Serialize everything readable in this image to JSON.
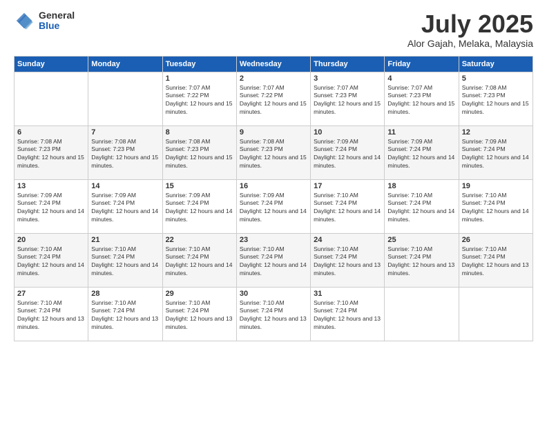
{
  "header": {
    "logo": {
      "general": "General",
      "blue": "Blue"
    },
    "title": "July 2025",
    "location": "Alor Gajah, Melaka, Malaysia"
  },
  "calendar": {
    "days_of_week": [
      "Sunday",
      "Monday",
      "Tuesday",
      "Wednesday",
      "Thursday",
      "Friday",
      "Saturday"
    ],
    "weeks": [
      [
        {
          "day": "",
          "info": ""
        },
        {
          "day": "",
          "info": ""
        },
        {
          "day": "1",
          "info": "Sunrise: 7:07 AM\nSunset: 7:22 PM\nDaylight: 12 hours and 15 minutes."
        },
        {
          "day": "2",
          "info": "Sunrise: 7:07 AM\nSunset: 7:22 PM\nDaylight: 12 hours and 15 minutes."
        },
        {
          "day": "3",
          "info": "Sunrise: 7:07 AM\nSunset: 7:23 PM\nDaylight: 12 hours and 15 minutes."
        },
        {
          "day": "4",
          "info": "Sunrise: 7:07 AM\nSunset: 7:23 PM\nDaylight: 12 hours and 15 minutes."
        },
        {
          "day": "5",
          "info": "Sunrise: 7:08 AM\nSunset: 7:23 PM\nDaylight: 12 hours and 15 minutes."
        }
      ],
      [
        {
          "day": "6",
          "info": "Sunrise: 7:08 AM\nSunset: 7:23 PM\nDaylight: 12 hours and 15 minutes."
        },
        {
          "day": "7",
          "info": "Sunrise: 7:08 AM\nSunset: 7:23 PM\nDaylight: 12 hours and 15 minutes."
        },
        {
          "day": "8",
          "info": "Sunrise: 7:08 AM\nSunset: 7:23 PM\nDaylight: 12 hours and 15 minutes."
        },
        {
          "day": "9",
          "info": "Sunrise: 7:08 AM\nSunset: 7:23 PM\nDaylight: 12 hours and 15 minutes."
        },
        {
          "day": "10",
          "info": "Sunrise: 7:09 AM\nSunset: 7:24 PM\nDaylight: 12 hours and 14 minutes."
        },
        {
          "day": "11",
          "info": "Sunrise: 7:09 AM\nSunset: 7:24 PM\nDaylight: 12 hours and 14 minutes."
        },
        {
          "day": "12",
          "info": "Sunrise: 7:09 AM\nSunset: 7:24 PM\nDaylight: 12 hours and 14 minutes."
        }
      ],
      [
        {
          "day": "13",
          "info": "Sunrise: 7:09 AM\nSunset: 7:24 PM\nDaylight: 12 hours and 14 minutes."
        },
        {
          "day": "14",
          "info": "Sunrise: 7:09 AM\nSunset: 7:24 PM\nDaylight: 12 hours and 14 minutes."
        },
        {
          "day": "15",
          "info": "Sunrise: 7:09 AM\nSunset: 7:24 PM\nDaylight: 12 hours and 14 minutes."
        },
        {
          "day": "16",
          "info": "Sunrise: 7:09 AM\nSunset: 7:24 PM\nDaylight: 12 hours and 14 minutes."
        },
        {
          "day": "17",
          "info": "Sunrise: 7:10 AM\nSunset: 7:24 PM\nDaylight: 12 hours and 14 minutes."
        },
        {
          "day": "18",
          "info": "Sunrise: 7:10 AM\nSunset: 7:24 PM\nDaylight: 12 hours and 14 minutes."
        },
        {
          "day": "19",
          "info": "Sunrise: 7:10 AM\nSunset: 7:24 PM\nDaylight: 12 hours and 14 minutes."
        }
      ],
      [
        {
          "day": "20",
          "info": "Sunrise: 7:10 AM\nSunset: 7:24 PM\nDaylight: 12 hours and 14 minutes."
        },
        {
          "day": "21",
          "info": "Sunrise: 7:10 AM\nSunset: 7:24 PM\nDaylight: 12 hours and 14 minutes."
        },
        {
          "day": "22",
          "info": "Sunrise: 7:10 AM\nSunset: 7:24 PM\nDaylight: 12 hours and 14 minutes."
        },
        {
          "day": "23",
          "info": "Sunrise: 7:10 AM\nSunset: 7:24 PM\nDaylight: 12 hours and 14 minutes."
        },
        {
          "day": "24",
          "info": "Sunrise: 7:10 AM\nSunset: 7:24 PM\nDaylight: 12 hours and 13 minutes."
        },
        {
          "day": "25",
          "info": "Sunrise: 7:10 AM\nSunset: 7:24 PM\nDaylight: 12 hours and 13 minutes."
        },
        {
          "day": "26",
          "info": "Sunrise: 7:10 AM\nSunset: 7:24 PM\nDaylight: 12 hours and 13 minutes."
        }
      ],
      [
        {
          "day": "27",
          "info": "Sunrise: 7:10 AM\nSunset: 7:24 PM\nDaylight: 12 hours and 13 minutes."
        },
        {
          "day": "28",
          "info": "Sunrise: 7:10 AM\nSunset: 7:24 PM\nDaylight: 12 hours and 13 minutes."
        },
        {
          "day": "29",
          "info": "Sunrise: 7:10 AM\nSunset: 7:24 PM\nDaylight: 12 hours and 13 minutes."
        },
        {
          "day": "30",
          "info": "Sunrise: 7:10 AM\nSunset: 7:24 PM\nDaylight: 12 hours and 13 minutes."
        },
        {
          "day": "31",
          "info": "Sunrise: 7:10 AM\nSunset: 7:24 PM\nDaylight: 12 hours and 13 minutes."
        },
        {
          "day": "",
          "info": ""
        },
        {
          "day": "",
          "info": ""
        }
      ]
    ]
  }
}
